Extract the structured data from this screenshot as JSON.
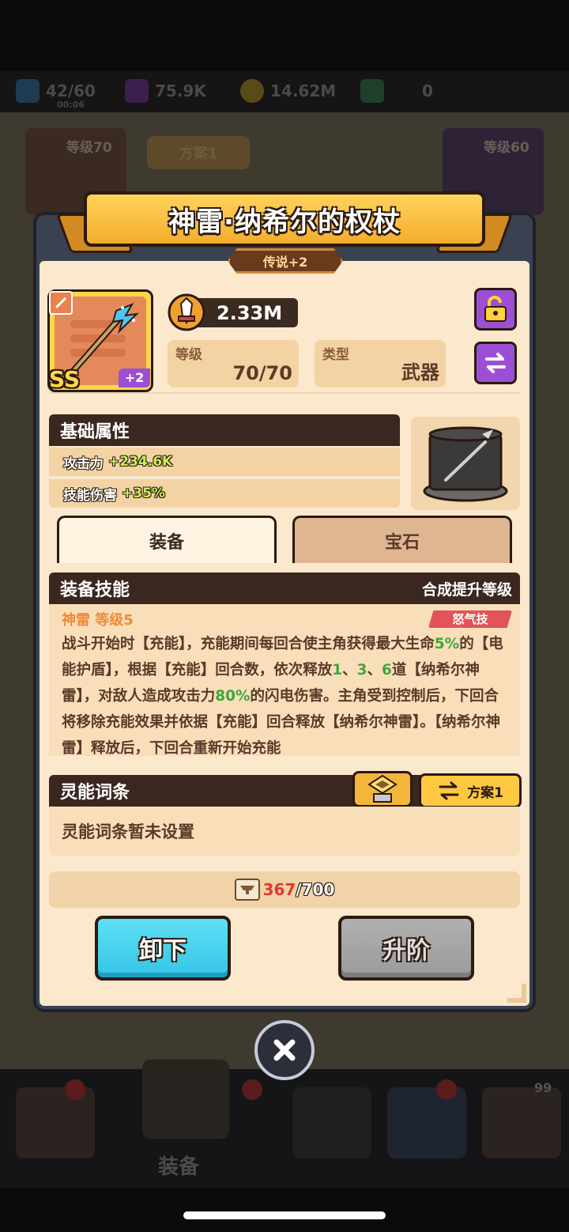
{
  "background": {
    "resources": [
      {
        "icon": "energy-icon",
        "value": "42/60",
        "sub": "00:06"
      },
      {
        "icon": "gem-icon",
        "value": "75.9K"
      },
      {
        "icon": "coin-icon",
        "value": "14.62M"
      },
      {
        "icon": "crystal-icon",
        "value": "0"
      }
    ],
    "left_card_level": "等级70",
    "right_card_level": "等级60",
    "scheme_label": "方案1",
    "nav_active_label": "装备",
    "nav_badge_count": "99"
  },
  "modal": {
    "title": "神雷·纳希尔的权杖",
    "rarity": "传说+2",
    "item": {
      "grade": "SS",
      "enhance": "+2",
      "power": "2.33M",
      "level_label": "等级",
      "level_value": "70/70",
      "type_label": "类型",
      "type_value": "武器"
    },
    "basic_attributes": {
      "header": "基础属性",
      "rows": [
        {
          "name": "攻击力",
          "value": "+234.6K"
        },
        {
          "name": "技能伤害",
          "value": "+35%"
        }
      ]
    },
    "tabs": {
      "equipment": "装备",
      "gem": "宝石"
    },
    "skill": {
      "header": "装备技能",
      "header_right": "合成提升等级",
      "name": "神雷 等级5",
      "tag": "怒气技",
      "desc": {
        "p1": "战斗开始时【充能】，充能期间每回合使主角获得最大生命",
        "pct1": "5%",
        "p2": "的【电能护盾】，根据【充能】回合数，依次释放",
        "n1": "1",
        "sep1": "、",
        "n2": "3",
        "sep2": "、",
        "n3": "6",
        "p3": "道【纳希尔神雷】，对敌人造成攻击力",
        "pct2": "80%",
        "p4": "的闪电伤害。主角受到控制后，下回合将移除充能效果并依据【充能】回合释放【纳希尔神雷】。【纳希尔神雷】释放后，下回合重新开始充能"
      }
    },
    "psionic": {
      "header": "灵能词条",
      "scheme": "方案1",
      "empty_text": "灵能词条暂未设置"
    },
    "material": {
      "current": "367",
      "max": "/700"
    },
    "buttons": {
      "unequip": "卸下",
      "ascend": "升阶"
    }
  },
  "colors": {
    "ribbon": "#f3ad2d",
    "panel": "#fbe8cd",
    "header_dark": "#3a2820",
    "cyan_button": "#35c4e6",
    "gray_button": "#9a9a9a",
    "purple_button": "#9c4fd4",
    "highlight_green": "#3fa83a",
    "stat_green": "#c8f05a",
    "rage_red": "#e0545a"
  }
}
